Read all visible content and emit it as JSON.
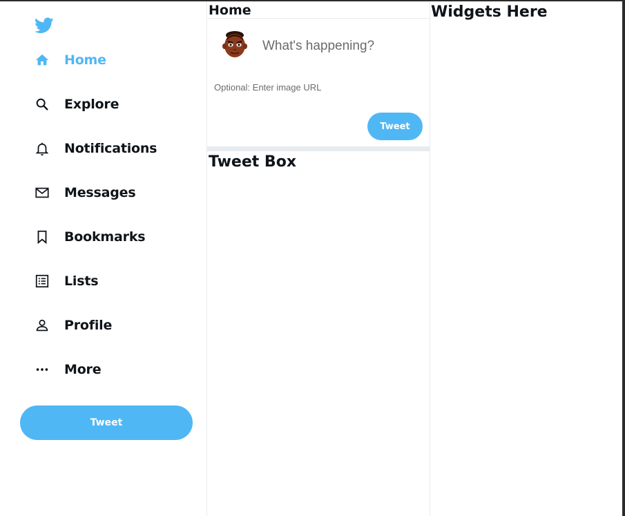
{
  "sidebar": {
    "logo": "twitter-bird-icon",
    "items": [
      {
        "label": "Home",
        "icon": "home-icon",
        "active": true
      },
      {
        "label": "Explore",
        "icon": "search-icon",
        "active": false
      },
      {
        "label": "Notifications",
        "icon": "bell-icon",
        "active": false
      },
      {
        "label": "Messages",
        "icon": "mail-icon",
        "active": false
      },
      {
        "label": "Bookmarks",
        "icon": "bookmark-icon",
        "active": false
      },
      {
        "label": "Lists",
        "icon": "list-icon",
        "active": false
      },
      {
        "label": "Profile",
        "icon": "person-icon",
        "active": false
      },
      {
        "label": "More",
        "icon": "more-icon",
        "active": false
      }
    ],
    "tweet_button": "Tweet"
  },
  "feed": {
    "header": "Home",
    "tweetbox": {
      "placeholder": "What's happening?",
      "image_placeholder": "Optional: Enter image URL",
      "tweet_button": "Tweet"
    },
    "placeholder_title": "Tweet Box"
  },
  "widgets": {
    "title": "Widgets Here"
  },
  "colors": {
    "accent": "#50b7f5",
    "divider": "#e6ecf0",
    "text": "#0f1419"
  }
}
